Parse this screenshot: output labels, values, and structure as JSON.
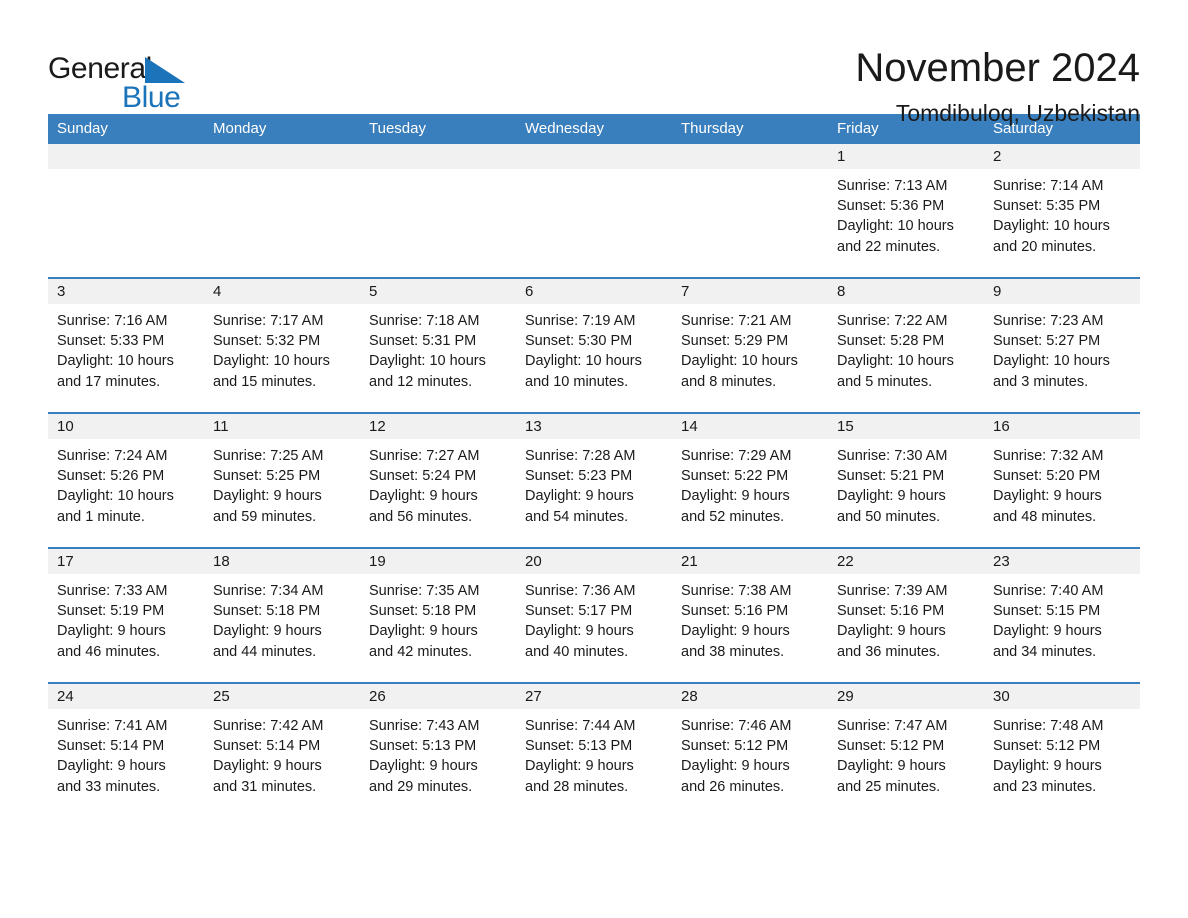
{
  "logo": {
    "word1": "General",
    "word2": "Blue",
    "flag_icon": "triangle-flag-icon",
    "brand_color": "#1b73ba"
  },
  "header": {
    "month_title": "November 2024",
    "location": "Tomdibuloq, Uzbekistan"
  },
  "colors": {
    "header_blue": "#3a7fbd",
    "day_band_gray": "#f1f1f1",
    "text": "#1a1a1a"
  },
  "weekdays": [
    "Sunday",
    "Monday",
    "Tuesday",
    "Wednesday",
    "Thursday",
    "Friday",
    "Saturday"
  ],
  "weeks": [
    [
      {
        "empty": true
      },
      {
        "empty": true
      },
      {
        "empty": true
      },
      {
        "empty": true
      },
      {
        "empty": true
      },
      {
        "day": "1",
        "sunrise": "Sunrise: 7:13 AM",
        "sunset": "Sunset: 5:36 PM",
        "daylight1": "Daylight: 10 hours",
        "daylight2": "and 22 minutes."
      },
      {
        "day": "2",
        "sunrise": "Sunrise: 7:14 AM",
        "sunset": "Sunset: 5:35 PM",
        "daylight1": "Daylight: 10 hours",
        "daylight2": "and 20 minutes."
      }
    ],
    [
      {
        "day": "3",
        "sunrise": "Sunrise: 7:16 AM",
        "sunset": "Sunset: 5:33 PM",
        "daylight1": "Daylight: 10 hours",
        "daylight2": "and 17 minutes."
      },
      {
        "day": "4",
        "sunrise": "Sunrise: 7:17 AM",
        "sunset": "Sunset: 5:32 PM",
        "daylight1": "Daylight: 10 hours",
        "daylight2": "and 15 minutes."
      },
      {
        "day": "5",
        "sunrise": "Sunrise: 7:18 AM",
        "sunset": "Sunset: 5:31 PM",
        "daylight1": "Daylight: 10 hours",
        "daylight2": "and 12 minutes."
      },
      {
        "day": "6",
        "sunrise": "Sunrise: 7:19 AM",
        "sunset": "Sunset: 5:30 PM",
        "daylight1": "Daylight: 10 hours",
        "daylight2": "and 10 minutes."
      },
      {
        "day": "7",
        "sunrise": "Sunrise: 7:21 AM",
        "sunset": "Sunset: 5:29 PM",
        "daylight1": "Daylight: 10 hours",
        "daylight2": "and 8 minutes."
      },
      {
        "day": "8",
        "sunrise": "Sunrise: 7:22 AM",
        "sunset": "Sunset: 5:28 PM",
        "daylight1": "Daylight: 10 hours",
        "daylight2": "and 5 minutes."
      },
      {
        "day": "9",
        "sunrise": "Sunrise: 7:23 AM",
        "sunset": "Sunset: 5:27 PM",
        "daylight1": "Daylight: 10 hours",
        "daylight2": "and 3 minutes."
      }
    ],
    [
      {
        "day": "10",
        "sunrise": "Sunrise: 7:24 AM",
        "sunset": "Sunset: 5:26 PM",
        "daylight1": "Daylight: 10 hours",
        "daylight2": "and 1 minute."
      },
      {
        "day": "11",
        "sunrise": "Sunrise: 7:25 AM",
        "sunset": "Sunset: 5:25 PM",
        "daylight1": "Daylight: 9 hours",
        "daylight2": "and 59 minutes."
      },
      {
        "day": "12",
        "sunrise": "Sunrise: 7:27 AM",
        "sunset": "Sunset: 5:24 PM",
        "daylight1": "Daylight: 9 hours",
        "daylight2": "and 56 minutes."
      },
      {
        "day": "13",
        "sunrise": "Sunrise: 7:28 AM",
        "sunset": "Sunset: 5:23 PM",
        "daylight1": "Daylight: 9 hours",
        "daylight2": "and 54 minutes."
      },
      {
        "day": "14",
        "sunrise": "Sunrise: 7:29 AM",
        "sunset": "Sunset: 5:22 PM",
        "daylight1": "Daylight: 9 hours",
        "daylight2": "and 52 minutes."
      },
      {
        "day": "15",
        "sunrise": "Sunrise: 7:30 AM",
        "sunset": "Sunset: 5:21 PM",
        "daylight1": "Daylight: 9 hours",
        "daylight2": "and 50 minutes."
      },
      {
        "day": "16",
        "sunrise": "Sunrise: 7:32 AM",
        "sunset": "Sunset: 5:20 PM",
        "daylight1": "Daylight: 9 hours",
        "daylight2": "and 48 minutes."
      }
    ],
    [
      {
        "day": "17",
        "sunrise": "Sunrise: 7:33 AM",
        "sunset": "Sunset: 5:19 PM",
        "daylight1": "Daylight: 9 hours",
        "daylight2": "and 46 minutes."
      },
      {
        "day": "18",
        "sunrise": "Sunrise: 7:34 AM",
        "sunset": "Sunset: 5:18 PM",
        "daylight1": "Daylight: 9 hours",
        "daylight2": "and 44 minutes."
      },
      {
        "day": "19",
        "sunrise": "Sunrise: 7:35 AM",
        "sunset": "Sunset: 5:18 PM",
        "daylight1": "Daylight: 9 hours",
        "daylight2": "and 42 minutes."
      },
      {
        "day": "20",
        "sunrise": "Sunrise: 7:36 AM",
        "sunset": "Sunset: 5:17 PM",
        "daylight1": "Daylight: 9 hours",
        "daylight2": "and 40 minutes."
      },
      {
        "day": "21",
        "sunrise": "Sunrise: 7:38 AM",
        "sunset": "Sunset: 5:16 PM",
        "daylight1": "Daylight: 9 hours",
        "daylight2": "and 38 minutes."
      },
      {
        "day": "22",
        "sunrise": "Sunrise: 7:39 AM",
        "sunset": "Sunset: 5:16 PM",
        "daylight1": "Daylight: 9 hours",
        "daylight2": "and 36 minutes."
      },
      {
        "day": "23",
        "sunrise": "Sunrise: 7:40 AM",
        "sunset": "Sunset: 5:15 PM",
        "daylight1": "Daylight: 9 hours",
        "daylight2": "and 34 minutes."
      }
    ],
    [
      {
        "day": "24",
        "sunrise": "Sunrise: 7:41 AM",
        "sunset": "Sunset: 5:14 PM",
        "daylight1": "Daylight: 9 hours",
        "daylight2": "and 33 minutes."
      },
      {
        "day": "25",
        "sunrise": "Sunrise: 7:42 AM",
        "sunset": "Sunset: 5:14 PM",
        "daylight1": "Daylight: 9 hours",
        "daylight2": "and 31 minutes."
      },
      {
        "day": "26",
        "sunrise": "Sunrise: 7:43 AM",
        "sunset": "Sunset: 5:13 PM",
        "daylight1": "Daylight: 9 hours",
        "daylight2": "and 29 minutes."
      },
      {
        "day": "27",
        "sunrise": "Sunrise: 7:44 AM",
        "sunset": "Sunset: 5:13 PM",
        "daylight1": "Daylight: 9 hours",
        "daylight2": "and 28 minutes."
      },
      {
        "day": "28",
        "sunrise": "Sunrise: 7:46 AM",
        "sunset": "Sunset: 5:12 PM",
        "daylight1": "Daylight: 9 hours",
        "daylight2": "and 26 minutes."
      },
      {
        "day": "29",
        "sunrise": "Sunrise: 7:47 AM",
        "sunset": "Sunset: 5:12 PM",
        "daylight1": "Daylight: 9 hours",
        "daylight2": "and 25 minutes."
      },
      {
        "day": "30",
        "sunrise": "Sunrise: 7:48 AM",
        "sunset": "Sunset: 5:12 PM",
        "daylight1": "Daylight: 9 hours",
        "daylight2": "and 23 minutes."
      }
    ]
  ]
}
